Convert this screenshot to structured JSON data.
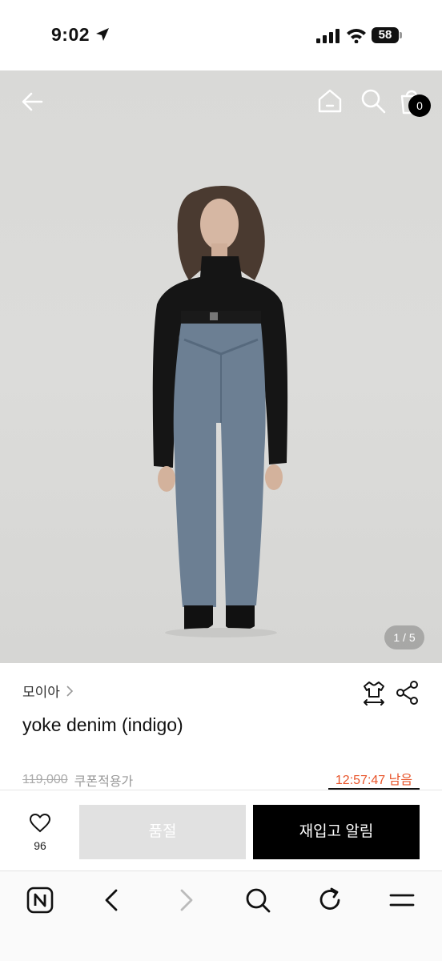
{
  "status_bar": {
    "time": "9:02",
    "battery": "58"
  },
  "hero": {
    "page_indicator": "1 / 5",
    "cart_count": "0"
  },
  "product": {
    "brand": "모이아",
    "name": "yoke denim (indigo)",
    "original_price": "119,000",
    "coupon_label": "쿠폰적용가",
    "timer": "12:57:47 남음"
  },
  "actions": {
    "like_count": "96",
    "soldout_label": "품절",
    "restock_label": "재입고 알림"
  },
  "icons": {
    "status": [
      "location-arrow-icon",
      "signal-icon",
      "wifi-icon",
      "battery-icon"
    ],
    "hero_nav": [
      "back-arrow-icon",
      "home-icon",
      "search-icon",
      "shopping-bag-icon"
    ],
    "product": [
      "chevron-right-icon",
      "size-guide-icon",
      "share-icon",
      "heart-icon"
    ],
    "browser": [
      "naver-n-icon",
      "back-chevron-icon",
      "forward-chevron-icon",
      "search-icon",
      "refresh-icon",
      "menu-icon"
    ]
  },
  "colors": {
    "accent_timer": "#e8542a",
    "primary_button": "#000000",
    "disabled_button": "#e1e1e1"
  }
}
